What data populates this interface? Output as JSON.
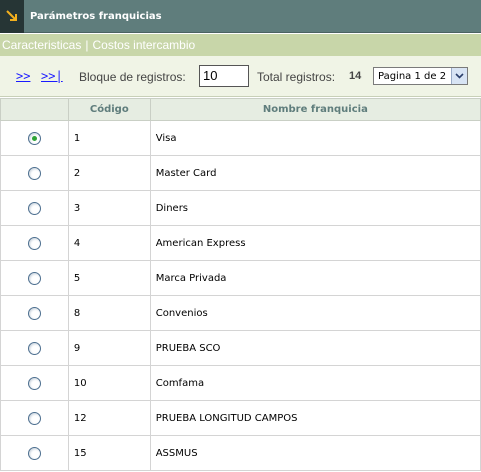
{
  "window": {
    "title": "Parámetros franquicias",
    "icon": "resize-arrow-icon"
  },
  "tabs": [
    {
      "label": "Caracteristicas"
    },
    {
      "label": "Costos intercambio"
    }
  ],
  "tab_separator": "|",
  "toolbar": {
    "next_label": ">>",
    "last_label": ">>|",
    "block_label": "Bloque de registros:",
    "block_value": "10",
    "total_label": "Total registros:",
    "total_value": "14",
    "page_select_value": "Pagina 1 de 2"
  },
  "table": {
    "headers": [
      "",
      "Código",
      "Nombre franquicia"
    ],
    "rows": [
      {
        "codigo": "1",
        "nombre": "Visa",
        "selected": true
      },
      {
        "codigo": "2",
        "nombre": "Master Card",
        "selected": false
      },
      {
        "codigo": "3",
        "nombre": "Diners",
        "selected": false
      },
      {
        "codigo": "4",
        "nombre": "American Express",
        "selected": false
      },
      {
        "codigo": "5",
        "nombre": "Marca Privada",
        "selected": false
      },
      {
        "codigo": "8",
        "nombre": "Convenios",
        "selected": false
      },
      {
        "codigo": "9",
        "nombre": "PRUEBA SCO",
        "selected": false
      },
      {
        "codigo": "10",
        "nombre": "Comfama",
        "selected": false
      },
      {
        "codigo": "12",
        "nombre": "PRUEBA LONGITUD CAMPOS",
        "selected": false
      },
      {
        "codigo": "15",
        "nombre": "ASSMUS",
        "selected": false
      }
    ]
  },
  "colors": {
    "titlebar": "#5f7d7c",
    "tabsbar": "#c8d6a9",
    "toolbar": "#f0f4e6",
    "header_text": "#5f7d7c",
    "selected_radio": "#2ea336"
  }
}
